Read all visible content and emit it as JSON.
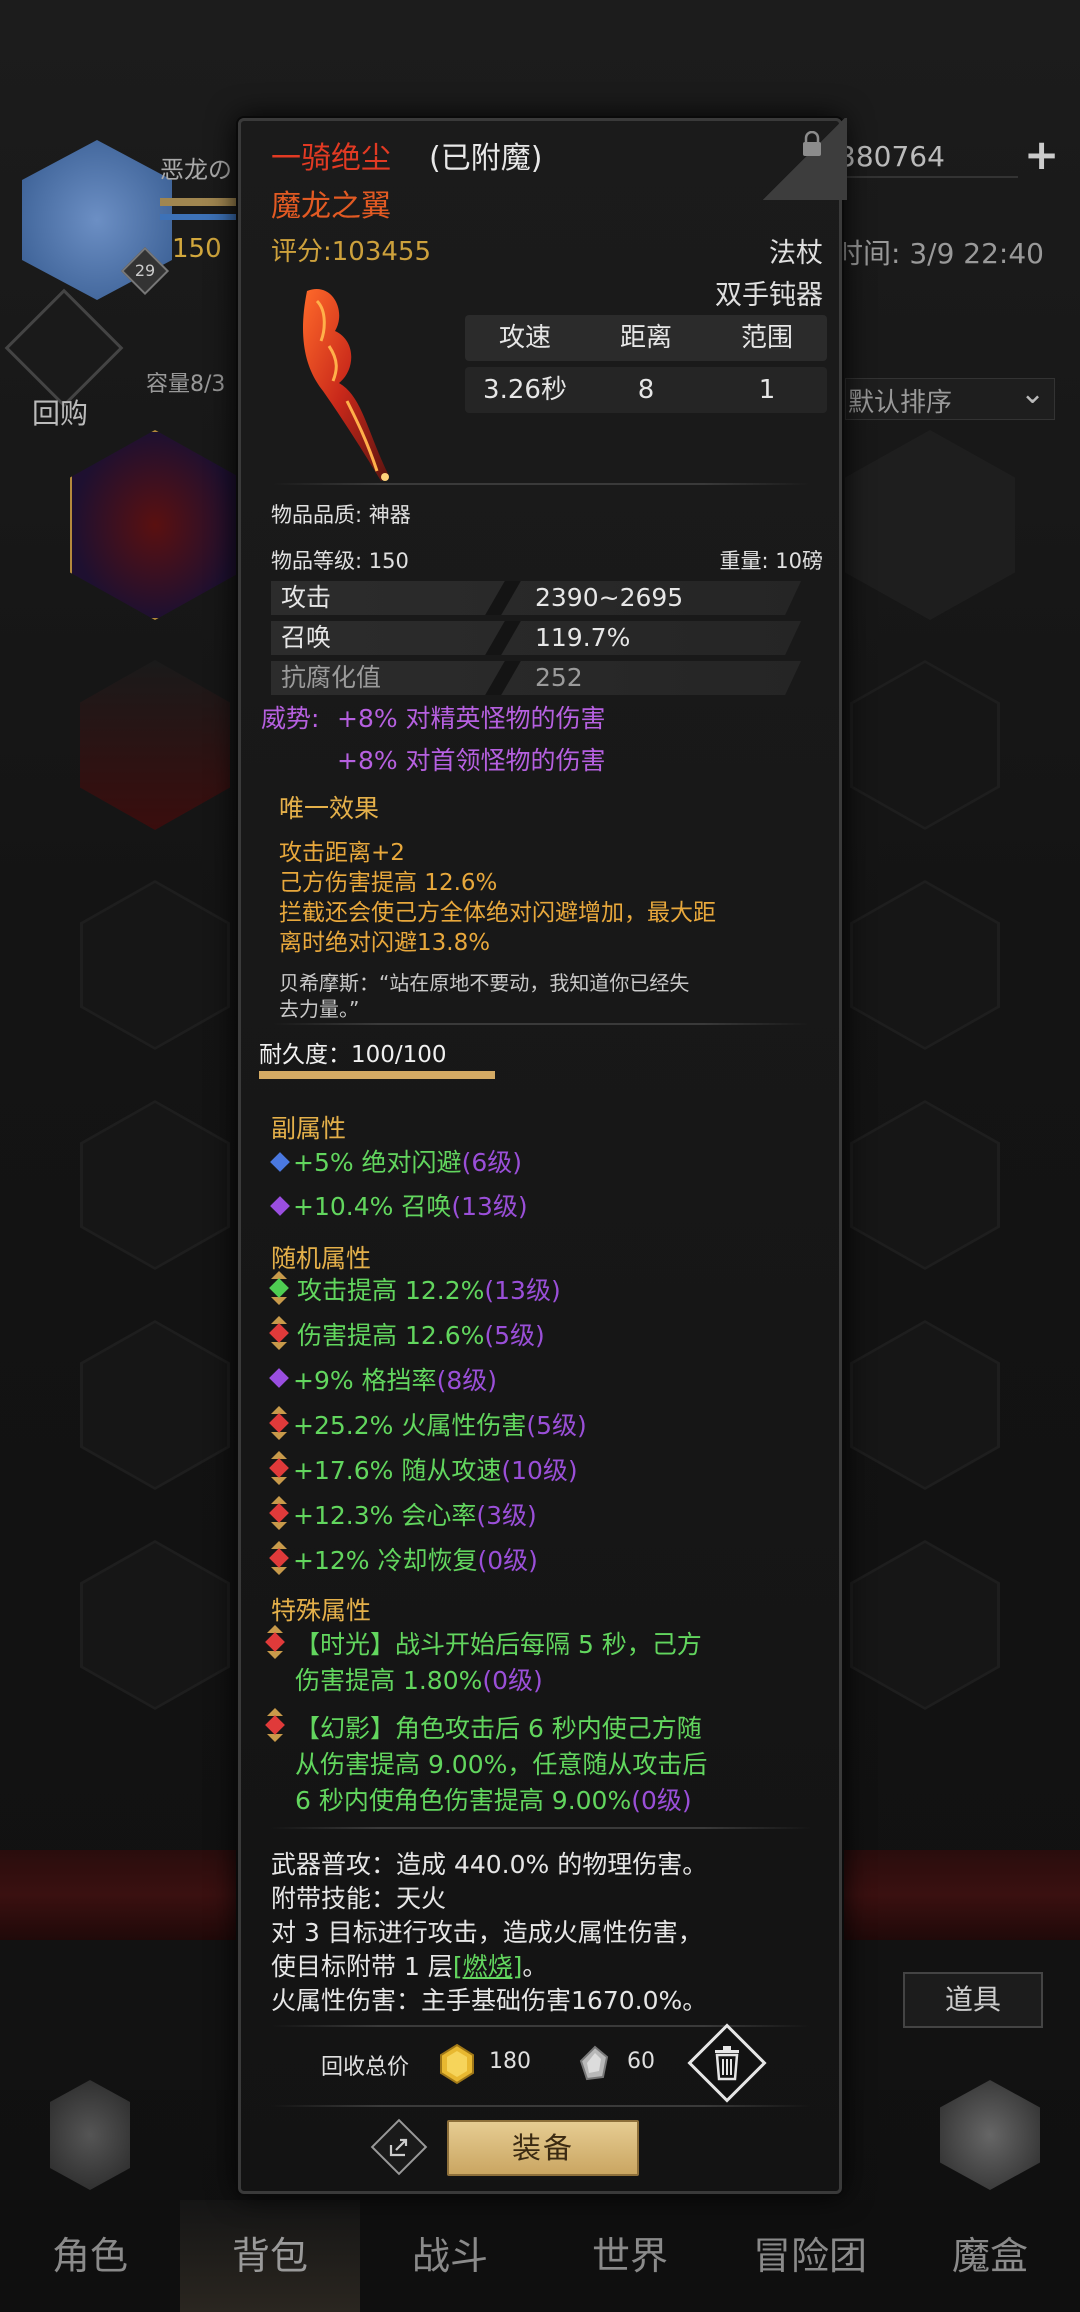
{
  "background": {
    "player_name": "恶龙の",
    "player_level": "29",
    "player_number": "150",
    "buyback_label": "回购",
    "capacity_label": "容量8/3",
    "currency_value": "380764",
    "time_label": "时间: 3/9 22:40",
    "sort_label": "默认排序",
    "items_button": "道具"
  },
  "item": {
    "name": "一骑绝尘",
    "enchant": "(已附魔)",
    "subtitle": "魔龙之翼",
    "score": "评分:103455",
    "type": "法杖",
    "subtype": "双手钝器",
    "stat_headers": [
      "攻速",
      "距离",
      "范围"
    ],
    "stat_values": [
      "3.26秒",
      "8",
      "1"
    ],
    "quality": "物品品质: 神器",
    "level": "物品等级: 150",
    "weight": "重量: 10磅",
    "attributes": [
      {
        "key": "攻击",
        "value": "2390~2695"
      },
      {
        "key": "召唤",
        "value": "119.7%"
      },
      {
        "key": "抗腐化值",
        "value": "252"
      }
    ],
    "momentum_label": "威势:",
    "momentum_lines": [
      "+8% 对精英怪物的伤害",
      "+8% 对首领怪物的伤害"
    ],
    "unique_title": "唯一效果",
    "unique_lines": [
      "攻击距离+2",
      "己方伤害提高 12.6%",
      "拦截还会使己方全体绝对闪避增加，最大距",
      "离时绝对闪避13.8%"
    ],
    "quote_lines": [
      "贝希摩斯：“站在原地不要动，我知道你已经失",
      "去力量。”"
    ],
    "durability": "耐久度：100/100",
    "durability_fraction": 1.0,
    "secondary_title": "副属性",
    "secondary": [
      {
        "text": "+5% 绝对闪避",
        "level": "(6级)",
        "gem": "blue"
      },
      {
        "text": "+10.4% 召唤",
        "level": "(13级)",
        "gem": "purple"
      }
    ],
    "random_title": "随机属性",
    "random": [
      {
        "text": "攻击提高 12.2%",
        "level": "(13级)",
        "gem": "green",
        "frame": true
      },
      {
        "text": "伤害提高 12.6%",
        "level": "(5级)",
        "gem": "red",
        "frame": true
      },
      {
        "text": "+9% 格挡率",
        "level": "(8级)",
        "gem": "purple",
        "frame": false
      },
      {
        "text": "+25.2% 火属性伤害",
        "level": "(5级)",
        "gem": "red",
        "frame": true
      },
      {
        "text": "+17.6% 随从攻速",
        "level": "(10级)",
        "gem": "red",
        "frame": true
      },
      {
        "text": "+12.3% 会心率",
        "level": "(3级)",
        "gem": "red",
        "frame": true
      },
      {
        "text": "+12% 冷却恢复",
        "level": "(0级)",
        "gem": "red",
        "frame": true
      }
    ],
    "special_title": "特殊属性",
    "special_1": [
      "【时光】战斗开始后每隔 5 秒，己方",
      "伤害提高 1.80%"
    ],
    "special_1_level": "(0级)",
    "special_2": [
      "【幻影】角色攻击后 6 秒内使己方随",
      "从伤害提高 9.00%，任意随从攻击后",
      "6 秒内使角色伤害提高 9.00%"
    ],
    "special_2_level": "(0级)",
    "weapon_attack": "武器普攻：造成 440.0% 的物理伤害。",
    "skill_label": "附带技能：天火",
    "skill_line1": "对 3 目标进行攻击，造成火属性伤害，",
    "skill_line2_prefix": "使目标附带 1 层",
    "skill_burn": "[燃烧]",
    "skill_line2_suffix": "。",
    "fire_damage": "火属性伤害：主手基础伤害1670.0%。",
    "recycle_label": "回收总价",
    "recycle_gold": "180",
    "recycle_material": "60",
    "equip_button": "装备"
  },
  "bottom_nav": [
    "角色",
    "背包",
    "战斗",
    "世界",
    "冒险团",
    "魔盒"
  ],
  "colors": {
    "legendary_red": "#e23a23",
    "gold": "#cda13c",
    "purple": "#b660e0",
    "green": "#62d65e",
    "burn_link": "#62d65e"
  }
}
